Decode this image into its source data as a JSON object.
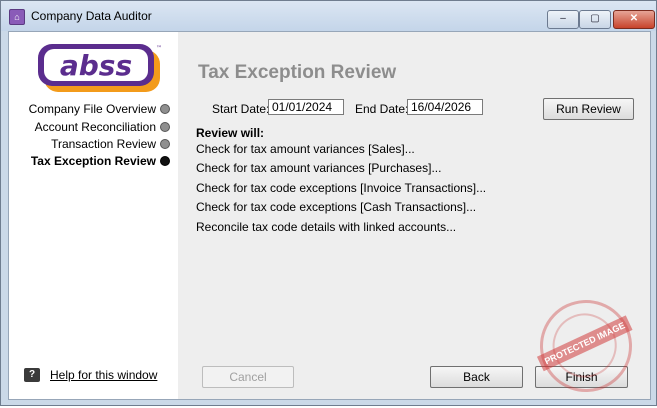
{
  "window": {
    "title": "Company Data Auditor",
    "controls": {
      "minimize": "‒",
      "maximize": "▢",
      "close": "✕"
    }
  },
  "logo": {
    "text": "abss",
    "mark": "™"
  },
  "sidebar": {
    "items": [
      {
        "label": "Company File Overview",
        "active": false
      },
      {
        "label": "Account Reconciliation",
        "active": false
      },
      {
        "label": "Transaction Review",
        "active": false
      },
      {
        "label": "Tax Exception Review",
        "active": true
      }
    ],
    "help_link": "Help for this window",
    "help_icon": "?"
  },
  "main": {
    "heading": "Tax Exception Review",
    "start_date_label": "Start Date:",
    "start_date": "01/01/2024",
    "end_date_label": "End Date:",
    "end_date": "16/04/2026",
    "run_review": "Run Review",
    "review_title": "Review will:",
    "checks": [
      "Check for tax amount variances [Sales]...",
      "Check for tax amount variances [Purchases]...",
      "Check for tax code exceptions [Invoice Transactions]...",
      "Check for tax code exceptions [Cash Transactions]...",
      "Reconcile tax code details with linked accounts..."
    ]
  },
  "footer": {
    "cancel": "Cancel",
    "back": "Back",
    "finish": "Finish"
  },
  "watermark": {
    "text": "PROTECTED IMAGE"
  },
  "colors": {
    "accent": "#5b2d8e",
    "logo_orange": "#f39b1b",
    "heading_gray": "#8d8d8d"
  }
}
